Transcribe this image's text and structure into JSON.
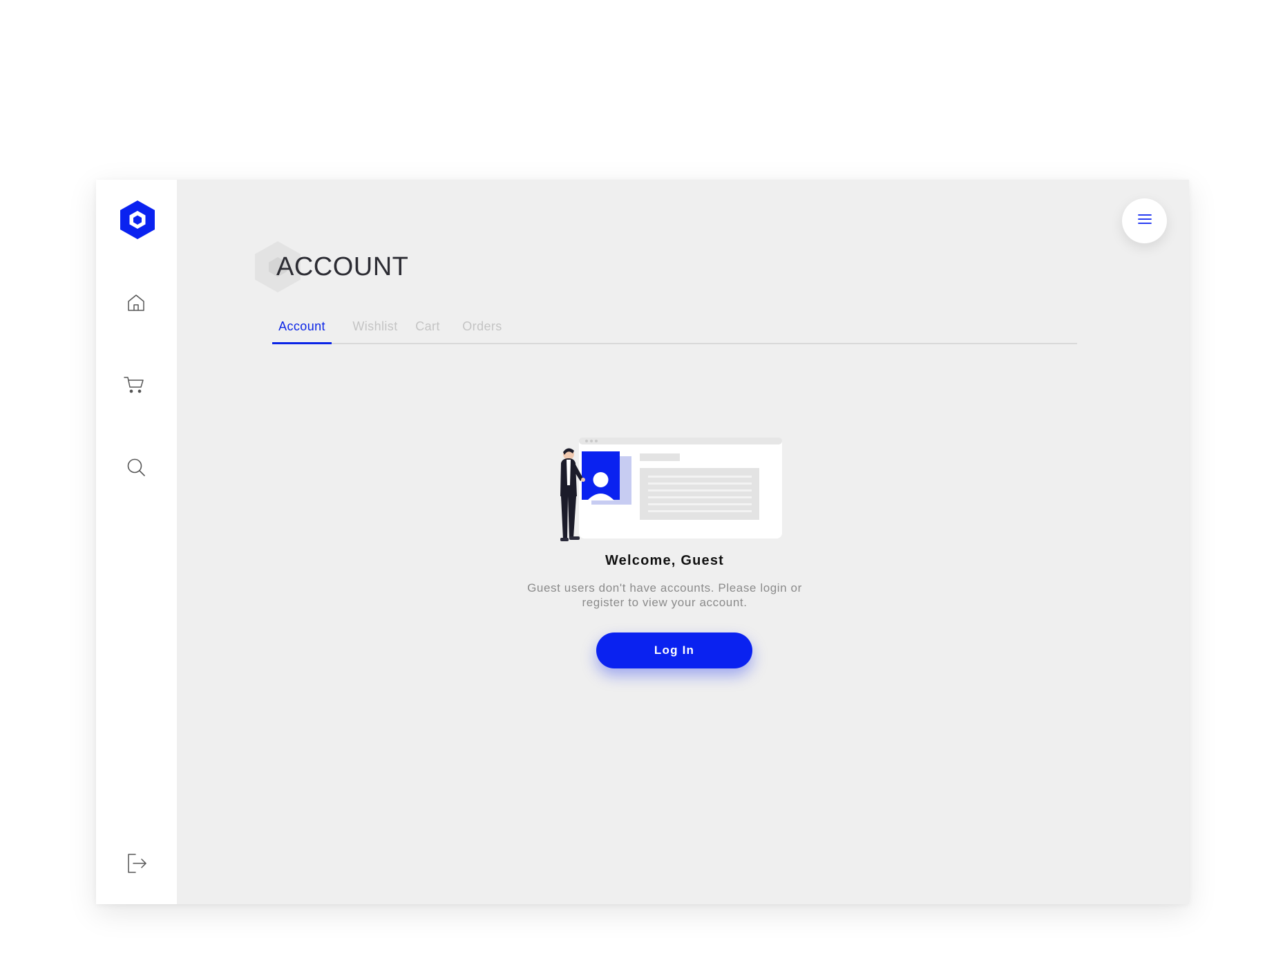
{
  "brand": {
    "logo_icon": "hexagon-logo-icon",
    "accent_color": "#0a22f0"
  },
  "sidebar": {
    "items": [
      {
        "icon": "home-icon"
      },
      {
        "icon": "cart-icon"
      },
      {
        "icon": "search-icon"
      },
      {
        "icon": "logout-icon"
      }
    ]
  },
  "header": {
    "menu_icon": "hamburger-menu-icon"
  },
  "page": {
    "title": "ACCOUNT",
    "tabs": [
      {
        "label": "Account",
        "active": true
      },
      {
        "label": "Wishlist",
        "active": false
      },
      {
        "label": "Cart",
        "active": false
      },
      {
        "label": "Orders",
        "active": false
      }
    ]
  },
  "empty_state": {
    "heading": "Welcome, Guest",
    "message_line1": "Guest users don't have accounts. Please login or",
    "message_line2": "register to view your account.",
    "login_label": "Log In"
  }
}
